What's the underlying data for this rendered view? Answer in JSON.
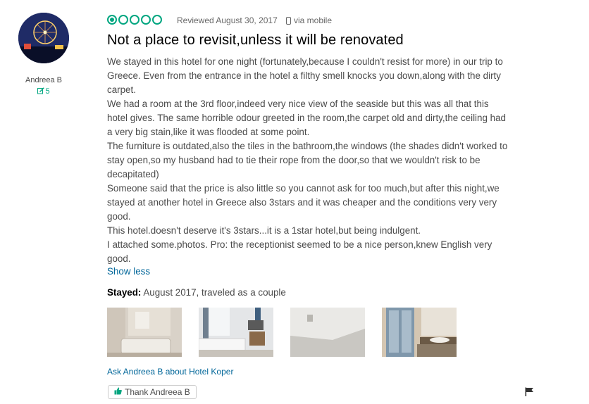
{
  "user": {
    "name": "Andreea B",
    "contributions": "5",
    "avatar_icon": "ferris-wheel-night-photo",
    "contrib_icon": "pencil-icon"
  },
  "review": {
    "rating": 1,
    "rating_max": 5,
    "date": "Reviewed August 30, 2017",
    "via": "via mobile",
    "title": "Not a place to revisit,unless it will be renovated",
    "paragraphs": [
      "We stayed in this hotel for one night (fortunately,because I couldn't resist for more) in our trip to Greece. Even from the entrance in the hotel a filthy smell knocks you down,along with the dirty carpet.",
      "We had a room at the 3rd floor,indeed very nice view of the seaside but this was all that this hotel gives. The same horrible odour greeted in the room,the carpet old and dirty,the ceiling had a very big stain,like it was flooded at some point.",
      "The furniture is outdated,also the tiles in the bathroom,the windows (the shades didn't worked to stay open,so my husband had to tie their rope from the door,so that we wouldn't risk to be decapitated)",
      "Someone said that the price is also little so you cannot ask for too much,but after this night,we stayed at another hotel in Greece also 3stars and it was cheaper and the conditions very very good.",
      "This hotel.doesn't deserve it's 3stars...it is a 1star hotel,but being indulgent.",
      "I attached some.photos. Pro: the receptionist seemed to be a nice person,knew English very good."
    ],
    "show_less": "Show less",
    "stayed_label": "Stayed:",
    "stayed_value": " August 2017, traveled as a couple"
  },
  "photos": [
    {
      "name": "bathroom-photo"
    },
    {
      "name": "bedroom-photo"
    },
    {
      "name": "ceiling-photo"
    },
    {
      "name": "window-sink-photo"
    }
  ],
  "actions": {
    "ask": "Ask Andreea B about Hotel Koper",
    "thank": "Thank Andreea B",
    "thank_icon": "thumbs-up-icon",
    "flag_icon": "flag-icon"
  },
  "colors": {
    "accent": "#00a680",
    "link": "#006699",
    "title": "#000000",
    "text": "#4a4a4a"
  }
}
